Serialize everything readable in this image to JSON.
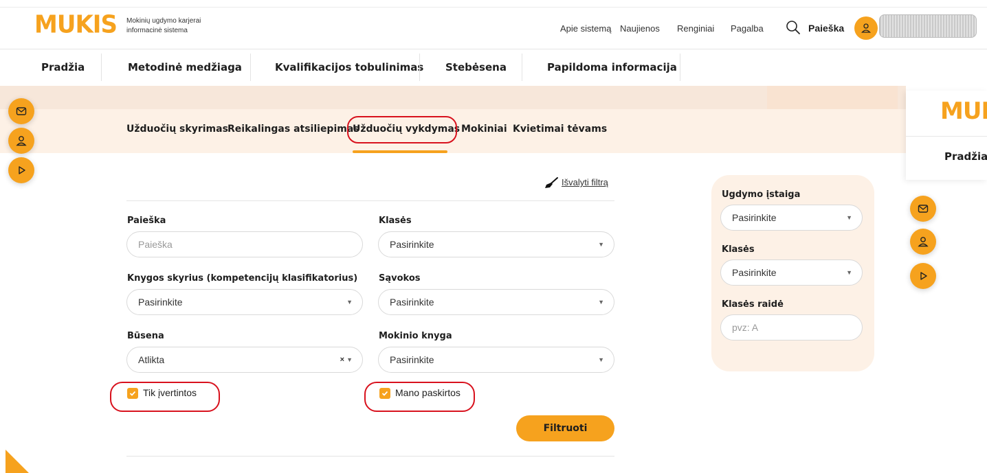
{
  "header": {
    "logo": "MUKIS",
    "tagline": "Mokinių ugdymo karjerai informacinė sistema",
    "links": [
      "Apie sistemą",
      "Naujienos",
      "Renginiai",
      "Pagalba"
    ],
    "search_label": "Paieška",
    "icons": [
      "search-icon",
      "user-icon"
    ]
  },
  "nav": {
    "items": [
      "Pradžia",
      "Metodinė medžiaga",
      "Kvalifikacijos tobulinimas",
      "Stebėsena",
      "Papildoma informacija"
    ]
  },
  "subtabs": {
    "items": [
      "Užduočių skyrimas",
      "Reikalingas atsiliepimas",
      "Užduočių vykdymas",
      "Mokiniai",
      "Kvietimai tėvams"
    ],
    "active": "Užduočių vykdymas"
  },
  "filters": {
    "clear_label": "Išvalyti filtrą",
    "search_label": "Paieška",
    "search_placeholder": "Paieška",
    "classes_label": "Klasės",
    "classes_value": "Pasirinkite",
    "chapter_label": "Knygos skyrius (kompetencijų klasifikatorius)",
    "chapter_value": "Pasirinkite",
    "concepts_label": "Sąvokos",
    "concepts_value": "Pasirinkite",
    "status_label": "Būsena",
    "status_value": "Atlikta",
    "book_label": "Mokinio knyga",
    "book_value": "Pasirinkite",
    "only_rated_label": "Tik įvertintos",
    "only_rated_checked": true,
    "my_assigned_label": "Mano paskirtos",
    "my_assigned_checked": true,
    "filter_button": "Filtruoti"
  },
  "side_panel": {
    "institution_label": "Ugdymo įstaiga",
    "institution_value": "Pasirinkite",
    "classes_label": "Klasės",
    "classes_value": "Pasirinkite",
    "class_letter_label": "Klasės raidė",
    "class_letter_placeholder": "pvz: A"
  },
  "background_window": {
    "logo": "MUKIS",
    "nav_item": "Pradžia"
  },
  "colors": {
    "accent": "#f6a21e",
    "band": "#fdf1e6",
    "annotation": "#d8111d"
  }
}
